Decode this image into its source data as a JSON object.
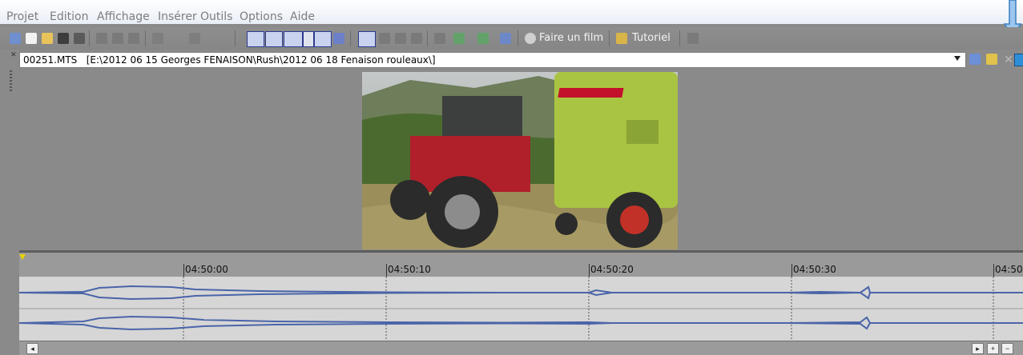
{
  "menu": [
    "Projet",
    "Edition",
    "Affichage",
    "Insérer",
    "Outils",
    "Options",
    "Aide"
  ],
  "toolbar": {
    "make_movie_label": "Faire un film",
    "tutorial_label": "Tutoriel"
  },
  "file": {
    "name": "00251.MTS",
    "path": "[E:\\2012 06 15 Georges FENAISON\\Rush\\2012 06 18 Fenaison  rouleaux\\]"
  },
  "timeline": {
    "ticks": [
      "04:50:00",
      "04:50:10",
      "04:50:20",
      "04:50:30",
      "04:50"
    ]
  },
  "colors": {
    "accent": "#e8d400",
    "wave": "#4a64a8",
    "background": "#8a8a8a"
  }
}
